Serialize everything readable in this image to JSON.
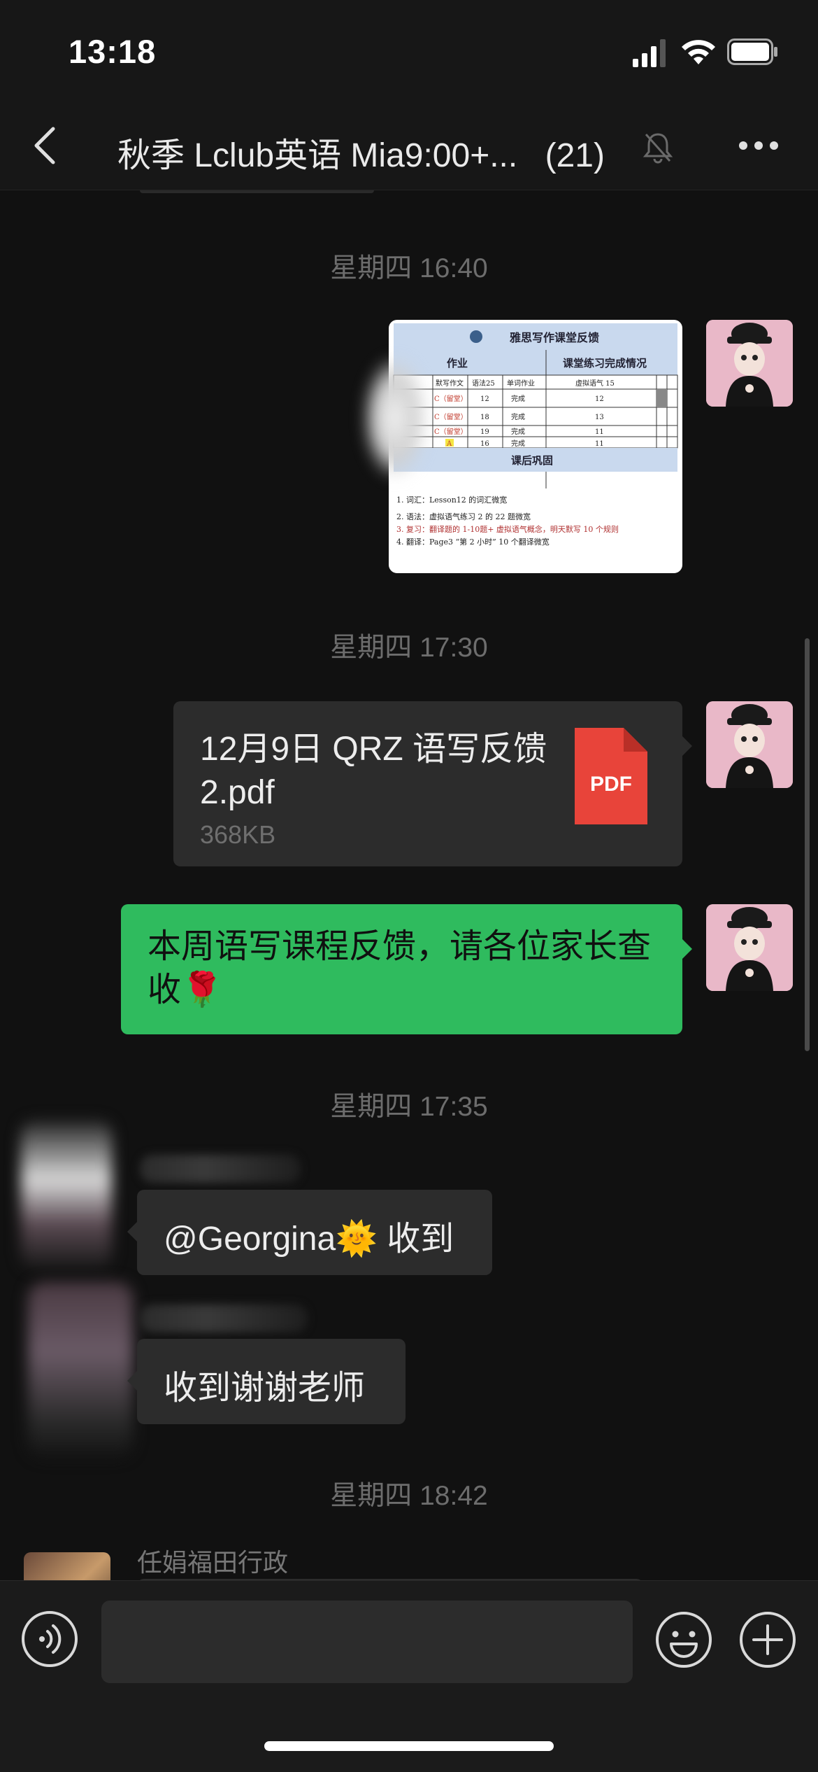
{
  "status_bar": {
    "time": "13:18"
  },
  "nav": {
    "title": "秋季 Lclub英语 Mia9:00+...",
    "member_count": "(21)"
  },
  "messages": {
    "ts1": "星期四 16:40",
    "image_card": {
      "header": "雅思写作课堂反馈",
      "section_homework": "作业",
      "section_class": "课堂练习完成情况",
      "col_headers": [
        "默写作文",
        "语法25",
        "单词作业",
        "虚拟语气 15"
      ],
      "rows": [
        [
          "C（留堂）",
          "12",
          "完成",
          "12"
        ],
        [
          "C（留堂）",
          "18",
          "完成",
          "13"
        ],
        [
          "C（留堂）",
          "19",
          "完成",
          "11"
        ],
        [
          "A",
          "16",
          "完成",
          "11"
        ]
      ],
      "section_after": "课后巩固",
      "items": [
        "1. 词汇：Lesson12 的词汇微宽",
        "2. 语法：虚拟语气练习 2 的 22 题微宽",
        "3. 复习：翻译题的 1-10题+ 虚拟语气概念，明天默写 10 个规则",
        "4. 翻译：Page3 “第 2 小时” 10 个翻译微宽"
      ]
    },
    "ts2": "星期四 17:30",
    "file": {
      "name": "12月9日 QRZ 语写反馈 2.pdf",
      "size": "368KB",
      "badge": "PDF"
    },
    "green_text": "本周语写课程反馈，请各位家长查收🌹",
    "ts3": "星期四 17:35",
    "reply1": "@Georgina🌞 收到",
    "reply2": "收到谢谢老师",
    "ts4": "星期四 18:42",
    "sender_last": "任娟福田行政"
  },
  "colors": {
    "accent_green": "#2fbb5e",
    "bubble_gray": "#2c2c2c",
    "pdf_red": "#e8443a"
  }
}
